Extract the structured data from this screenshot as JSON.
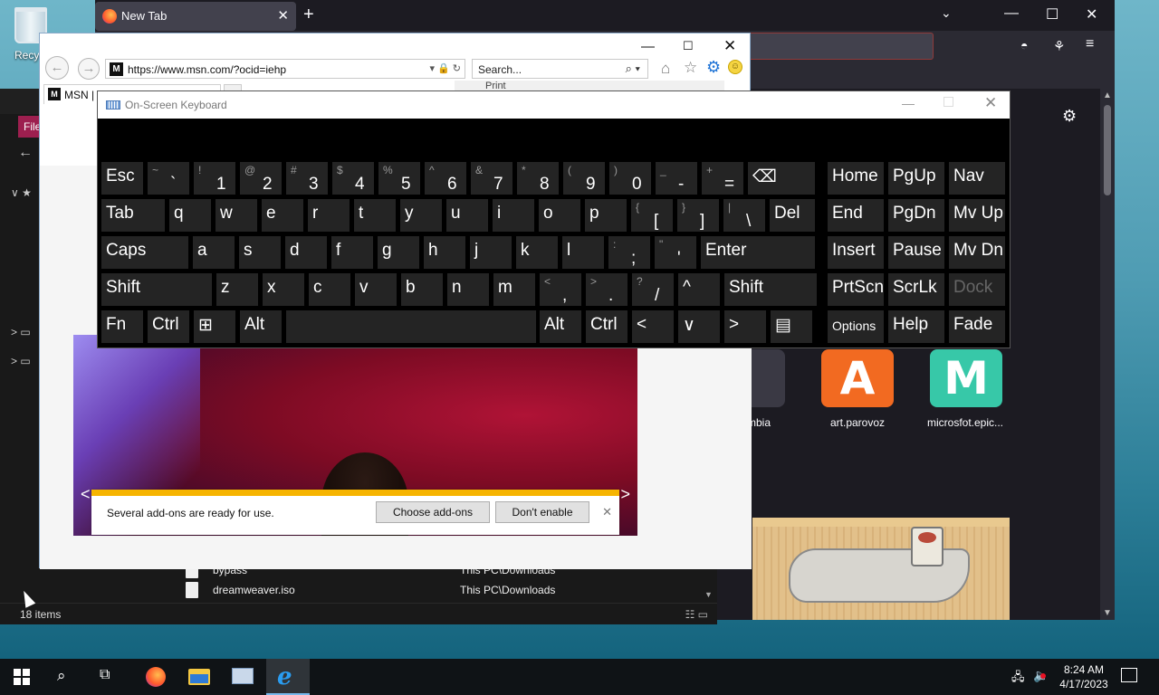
{
  "desktop": {
    "recycle_label": "Recycl"
  },
  "firefox": {
    "tab_title": "New Tab",
    "new_tab_glyph": "+",
    "close_glyph": "✕",
    "listall_glyph": "⌄",
    "min_glyph": "—",
    "max_glyph": "☐",
    "win_close_glyph": "✕",
    "pocket_glyph": "◓",
    "ext_glyph": "⚘",
    "menu_glyph": "≡",
    "gear_glyph": "⚙",
    "tiles": [
      {
        "label": "mbia",
        "letter": ""
      },
      {
        "label": "art.parovoz",
        "letter": "A",
        "color": "#f26a21"
      },
      {
        "label": "microsfot.epic...",
        "letter": "M",
        "color": "#37c8a8"
      }
    ]
  },
  "explorer": {
    "file_tab": "File",
    "back_glyph": "←",
    "tree": [
      "∨ ★",
      "> ▭",
      "> ▭"
    ],
    "rows": [
      {
        "name": "bypass",
        "path": "This PC\\Downloads"
      },
      {
        "name": "dreamweaver.iso",
        "path": "This PC\\Downloads"
      }
    ],
    "status_count": "18 items",
    "views_glyph": "☷ ▭"
  },
  "ie": {
    "url": "https://www.msn.com/?ocid=iehp",
    "addr_tools": "▾ 🔒 ↻",
    "search_placeholder": "Search...",
    "search_glyph": "⌕ ▾",
    "tab_title": "MSN | Outlook, Office, Sk",
    "print_label": "Print",
    "back_glyph": "←",
    "fwd_glyph": "→",
    "home_glyph": "⌂",
    "fav_glyph": "☆",
    "tools_glyph": "⚙",
    "smiley_glyph": "☺",
    "min_glyph": "—",
    "max_glyph": "☐",
    "close_glyph": "✕",
    "hero_prev": "<",
    "hero_next": ">",
    "addon": {
      "message": "Several add-ons are ready for use.",
      "choose_label": "Choose add-ons",
      "dont_label": "Don't enable",
      "close_glyph": "✕"
    }
  },
  "osk": {
    "title": "On-Screen Keyboard",
    "min_glyph": "—",
    "close_glyph": "✕",
    "rows": [
      [
        {
          "k": "Esc"
        },
        {
          "s": "~",
          "m": "`"
        },
        {
          "s": "!",
          "m": "1"
        },
        {
          "s": "@",
          "m": "2"
        },
        {
          "s": "#",
          "m": "3"
        },
        {
          "s": "$",
          "m": "4"
        },
        {
          "s": "%",
          "m": "5"
        },
        {
          "s": "^",
          "m": "6"
        },
        {
          "s": "&",
          "m": "7"
        },
        {
          "s": "*",
          "m": "8"
        },
        {
          "s": "(",
          "m": "9"
        },
        {
          "s": ")",
          "m": "0"
        },
        {
          "s": "_",
          "m": "-"
        },
        {
          "s": "+",
          "m": "="
        },
        {
          "k": "⌫"
        },
        {
          "k": "Home"
        },
        {
          "k": "PgUp"
        },
        {
          "k": "Nav"
        }
      ],
      [
        {
          "k": "Tab"
        },
        {
          "k": "q"
        },
        {
          "k": "w"
        },
        {
          "k": "e"
        },
        {
          "k": "r"
        },
        {
          "k": "t"
        },
        {
          "k": "y"
        },
        {
          "k": "u"
        },
        {
          "k": "i"
        },
        {
          "k": "o"
        },
        {
          "k": "p"
        },
        {
          "s": "{",
          "m": "["
        },
        {
          "s": "}",
          "m": "]"
        },
        {
          "s": "|",
          "m": "\\"
        },
        {
          "k": "Del"
        },
        {
          "k": "End"
        },
        {
          "k": "PgDn"
        },
        {
          "k": "Mv Up"
        }
      ],
      [
        {
          "k": "Caps"
        },
        {
          "k": "a"
        },
        {
          "k": "s"
        },
        {
          "k": "d"
        },
        {
          "k": "f"
        },
        {
          "k": "g"
        },
        {
          "k": "h"
        },
        {
          "k": "j"
        },
        {
          "k": "k"
        },
        {
          "k": "l"
        },
        {
          "s": ":",
          "m": ";"
        },
        {
          "s": "\"",
          "m": "'"
        },
        {
          "k": "Enter"
        },
        {
          "k": "Insert"
        },
        {
          "k": "Pause"
        },
        {
          "k": "Mv Dn"
        }
      ],
      [
        {
          "k": "Shift"
        },
        {
          "k": "z"
        },
        {
          "k": "x"
        },
        {
          "k": "c"
        },
        {
          "k": "v"
        },
        {
          "k": "b"
        },
        {
          "k": "n"
        },
        {
          "k": "m"
        },
        {
          "s": "<",
          "m": ","
        },
        {
          "s": ">",
          "m": "."
        },
        {
          "s": "?",
          "m": "/"
        },
        {
          "k": "^"
        },
        {
          "k": "Shift"
        },
        {
          "k": "PrtScn"
        },
        {
          "k": "ScrLk"
        },
        {
          "k": "Dock"
        }
      ],
      [
        {
          "k": "Fn"
        },
        {
          "k": "Ctrl"
        },
        {
          "k": "⊞"
        },
        {
          "k": "Alt"
        },
        {
          "k": ""
        },
        {
          "k": "Alt"
        },
        {
          "k": "Ctrl"
        },
        {
          "k": "<"
        },
        {
          "k": "∨"
        },
        {
          "k": ">"
        },
        {
          "k": "▤"
        },
        {
          "k": "Options"
        },
        {
          "k": "Help"
        },
        {
          "k": "Fade"
        }
      ]
    ]
  },
  "taskbar": {
    "search_glyph": "⌕",
    "taskview_glyph": "⧉",
    "ie_glyph": "e",
    "net_glyph": "🖧",
    "vol_glyph": "🔈",
    "time": "8:24 AM",
    "date": "4/17/2023"
  }
}
